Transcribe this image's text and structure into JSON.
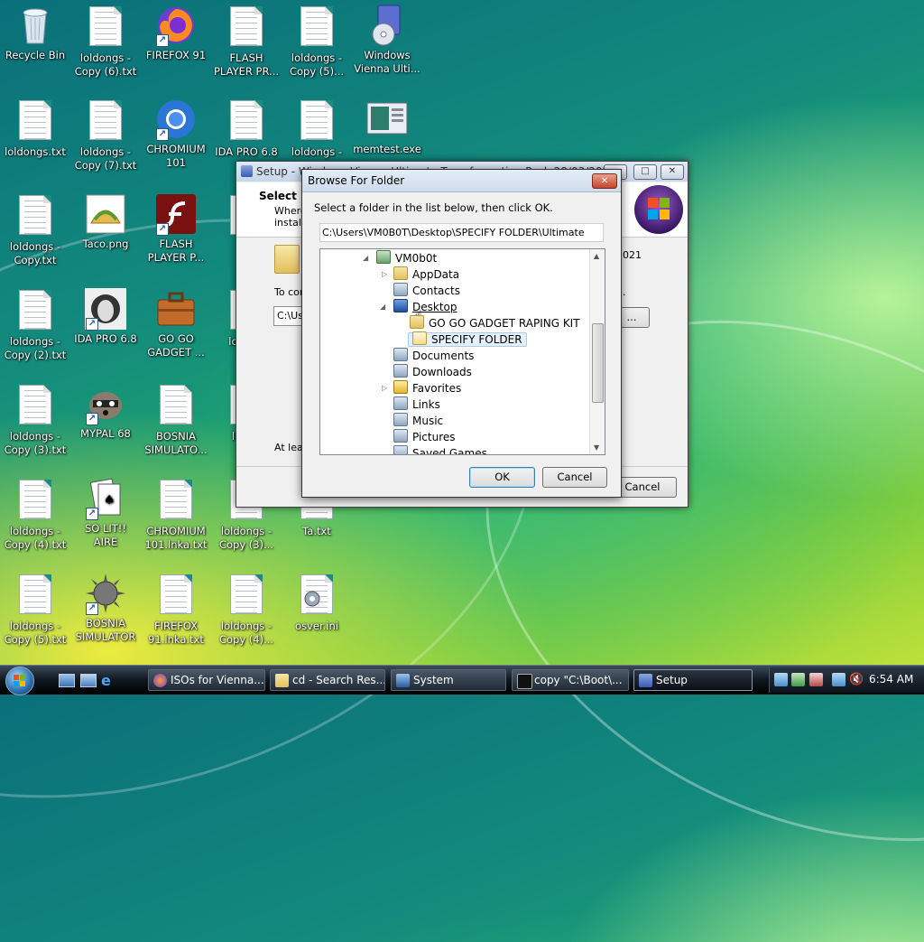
{
  "desktop": {
    "icons": [
      {
        "name": "Recycle Bin"
      },
      {
        "name": "loldongs - Copy (6).txt"
      },
      {
        "name": "FIREFOX 91"
      },
      {
        "name": "FLASH PLAYER PR..."
      },
      {
        "name": "loldongs - Copy (5)..."
      },
      {
        "name": "Windows Vienna Ulti..."
      },
      {
        "name": "loldongs.txt"
      },
      {
        "name": "loldongs - Copy (7).txt"
      },
      {
        "name": "CHROMIUM 101"
      },
      {
        "name": "IDA PRO 6.8"
      },
      {
        "name": "loldongs -"
      },
      {
        "name": "memtest.exe"
      },
      {
        "name": "loldongs - Copy.txt"
      },
      {
        "name": "Taco.png"
      },
      {
        "name": "FLASH PLAYER P..."
      },
      {
        "name": "lold"
      },
      {
        "name": "loldongs - Copy (2).txt"
      },
      {
        "name": "IDA PRO 6.8"
      },
      {
        "name": "GO GO GADGET ..."
      },
      {
        "name": "lol Cop"
      },
      {
        "name": "loldongs - Copy (3).txt"
      },
      {
        "name": "MYPAL 68"
      },
      {
        "name": "BOSNIA SIMULATO..."
      },
      {
        "name": "lol Co"
      },
      {
        "name": "loldongs - Copy (4).txt"
      },
      {
        "name": "SO LIT!! AIRE"
      },
      {
        "name": "CHROMIUM 101.lnka.txt"
      },
      {
        "name": "loldongs - Copy (3)..."
      },
      {
        "name": "Ta.txt"
      },
      {
        "name": "loldongs - Copy (5).txt"
      },
      {
        "name": "BOSNIA SIMULATOR"
      },
      {
        "name": "FIREFOX 91.lnka.txt"
      },
      {
        "name": "loldongs - Copy (4)..."
      },
      {
        "name": "osver.ini"
      }
    ]
  },
  "setup_window": {
    "title": "Setup - Windows Vienna Ultimate Transformation Pack 28/03/2021",
    "heading": "Select D",
    "desc_1": "Where",
    "desc_2": "installe",
    "date_fragment": "021",
    "to_continue": "To con",
    "path_value": "C:\\Use",
    "browse_label": "...",
    "at_least": "At leas",
    "cancel_label": "Cancel",
    "title_buttons": {
      "min": "—",
      "max": "□",
      "close": "✕"
    }
  },
  "browse_dialog": {
    "title": "Browse For Folder",
    "close_label": "✕",
    "instruction": "Select a folder in the list below, then click OK.",
    "path": "C:\\Users\\VM0B0T\\Desktop\\SPECIFY FOLDER\\Ultimate",
    "tree": [
      {
        "label": "VM0b0t"
      },
      {
        "label": "AppData"
      },
      {
        "label": "Contacts"
      },
      {
        "label": "Desktop"
      },
      {
        "label": "GO GO GADGET RAPING KIT"
      },
      {
        "label": "SPECIFY FOLDER"
      },
      {
        "label": "Documents"
      },
      {
        "label": "Downloads"
      },
      {
        "label": "Favorites"
      },
      {
        "label": "Links"
      },
      {
        "label": "Music"
      },
      {
        "label": "Pictures"
      },
      {
        "label": "Saved Games"
      }
    ],
    "ok_label": "OK",
    "cancel_label": "Cancel"
  },
  "taskbar": {
    "tasks": [
      {
        "label": "ISOs for Vienna..."
      },
      {
        "label": "cd - Search Res..."
      },
      {
        "label": "System"
      },
      {
        "label": "copy  \"C:\\Boot\\..."
      },
      {
        "label": "Setup"
      }
    ],
    "clock": "6:54 AM"
  },
  "colors": {
    "accent": "#3c7fb1",
    "selection": "#e6f0fb",
    "taskbar": "#0f1720"
  }
}
